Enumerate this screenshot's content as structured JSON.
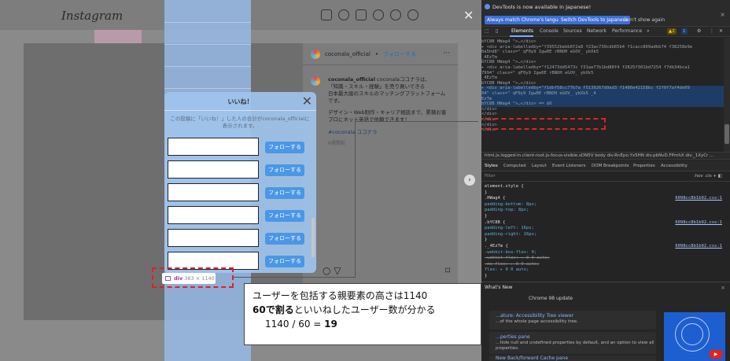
{
  "instagram": {
    "logo": "Instagram",
    "post": {
      "username": "coconala_official",
      "follow": "フォローする",
      "more": "···",
      "caption_user": "coconala_official",
      "caption_handle": "coconalaココナラは、",
      "caption_lines": [
        "「知識・スキル・経験」を売り買いできる",
        "日本最大級のスキルのマッチングプラットフォーム",
        "です。"
      ],
      "caption2_lines": [
        "デザイン・Web制作・キャリア相談まで、累積お客",
        "プロにネット英語で依頼できます！"
      ],
      "hashtag": "#coconala",
      "hashtag2": "ココナラ",
      "time": "6週間前"
    },
    "likes_modal": {
      "title": "いいね！",
      "close": "✕",
      "note": "この投稿に「いいね！」した人の合計がcoconala_officialに表示されます。",
      "follow_labels": [
        "フォローする",
        "フォローする",
        "フォローする",
        "フォローする",
        "フォローする",
        "フォローする"
      ]
    },
    "tooltip": {
      "tag": "div",
      "size": "383 × 1140"
    },
    "close": "✕",
    "next": "›"
  },
  "annotation": {
    "line1": "ユーザーを包括する親要素の高さは1140",
    "line2_bold": "60で割る",
    "line2_rest": "といいねしたユーザー数が分かる",
    "line3_prefix": "1140 / 60 = ",
    "line3_bold": "19"
  },
  "devtools": {
    "infobar": {
      "message": "DevTools is now available in Japanese!",
      "btn_match": "Always match Chrome's language",
      "btn_switch": "Switch DevTools to Japanese",
      "btn_dismiss": "Don't show again",
      "close": "×"
    },
    "tabs": [
      "Elements",
      "Console",
      "Sources",
      "Network",
      "Performance",
      "»"
    ],
    "warn_count": "▲2",
    "info_count": "1",
    "dom_lines": [
      {
        "t": "      bYC8B        HWag4              \">…</div>",
        "sel": false
      },
      {
        "t": "    ▸ <div aria-labelledby=\"f39552bebb8f2a8 f23ac739cdb65b4 f1cacc869adbb74 f38258e9e",
        "sel": false
      },
      {
        "t": "      0a5hd8\" class=\"        qF0y9          Igw0E   rBNOH      eGOV_      ybXk5",
        "sel": false
      },
      {
        "t": "      _4EzTm",
        "sel": false
      },
      {
        "t": "      bYC8B        HWag4              \">…</div>",
        "sel": false
      },
      {
        "t": "    ▸ <div aria-labelledby=\"f12473dd5473c f31ae77b1bd88f4 f2825f301bd7254 f7db34bca1",
        "sel": false
      },
      {
        "t": "      7994\" class=\"        qF0y9          Igw0E   rBNOH      eGOV_      ybXk5",
        "sel": false
      },
      {
        "t": "      _4EzTm",
        "sel": false
      },
      {
        "t": "      bYC8B        HWag4              \">…</div>",
        "sel": false
      },
      {
        "t": "    ▸ <div aria-labelledby=\"f1dbf58cc77b7a f5139267d9ad3 f1486e42158bc f2f0f7af4de09",
        "sel": true
      },
      {
        "t": "      94\" class=\"        qF0y9          Igw0E   rBNOH      eGOV_      ybXk5      _4",
        "sel": true
      },
      {
        "t": "      EzTm",
        "sel": true
      },
      {
        "t": "      bYC8B        HWag4              \">…</div> == $0",
        "sel": true
      },
      {
        "t": "    </div>",
        "sel": false
      },
      {
        "t": "    </div>",
        "sel": false
      },
      {
        "t": "   </div>",
        "sel": false
      },
      {
        "t": "  </div>",
        "sel": false
      },
      {
        "t": " </div>",
        "sel": false
      }
    ],
    "breadcrumb": "html.js.logged-in.client-root.js-focus-visible.sDN5V   body   div.RnEpo.Yx5HN   div.pbNvD.FPmhX   div._1XyCr   ...",
    "subtabs": [
      "Styles",
      "Computed",
      "Layout",
      "Event Listeners",
      "DOM Breakpoints",
      "Properties",
      "Accessibility"
    ],
    "filter_placeholder": "Filter",
    "filter_tools": ":hov  .cls  +  ◧",
    "styles": [
      {
        "t": "element.style {",
        "cls": "css-sel",
        "src": ""
      },
      {
        "t": "}",
        "cls": "css-sel",
        "src": ""
      },
      {
        "t": ".HWag4 {",
        "cls": "css-sel",
        "src": "6098cc8b1b92.css:1"
      },
      {
        "t": "  padding-bottom: 8px;",
        "cls": "css-prop",
        "src": ""
      },
      {
        "t": "  padding-top: 8px;",
        "cls": "css-prop",
        "src": ""
      },
      {
        "t": "}",
        "cls": "css-sel",
        "src": ""
      },
      {
        "t": ".bYC8B {",
        "cls": "css-sel",
        "src": "6098cc8b1b92.css:1"
      },
      {
        "t": "  padding-left: 16px;",
        "cls": "css-prop",
        "src": ""
      },
      {
        "t": "  padding-right: 16px;",
        "cls": "css-prop",
        "src": ""
      },
      {
        "t": "}",
        "cls": "css-sel",
        "src": ""
      },
      {
        "t": "._4EzTm {",
        "cls": "css-sel",
        "src": "6098cc8b1b92.css:1"
      },
      {
        "t": "  -webkit-box-flex: 0;",
        "cls": "css-prop",
        "src": ""
      },
      {
        "t": "  -webkit-flex: ▸ 0 0 auto;",
        "cls": "css-strike",
        "src": ""
      },
      {
        "t": "  -ms-flex: ▸ 0 0 auto;",
        "cls": "css-strike",
        "src": ""
      },
      {
        "t": "  flex: ▸ 0 0 auto;",
        "cls": "css-prop",
        "src": ""
      },
      {
        "t": "}",
        "cls": "css-sel",
        "src": ""
      }
    ],
    "drawer": {
      "tab": "What's New",
      "close": "×",
      "subtitle": "Chrome 98 update",
      "cards": [
        {
          "title": "…ature: Accessibility Tree viewer",
          "text": "…of the whole page accessibility tree."
        },
        {
          "title": "…perties pane",
          "text": "…hide null and undefined properties by default,\nand an option to view all properties."
        },
        {
          "title": "New Back/forward Cache pane",
          "text": ""
        }
      ]
    }
  }
}
